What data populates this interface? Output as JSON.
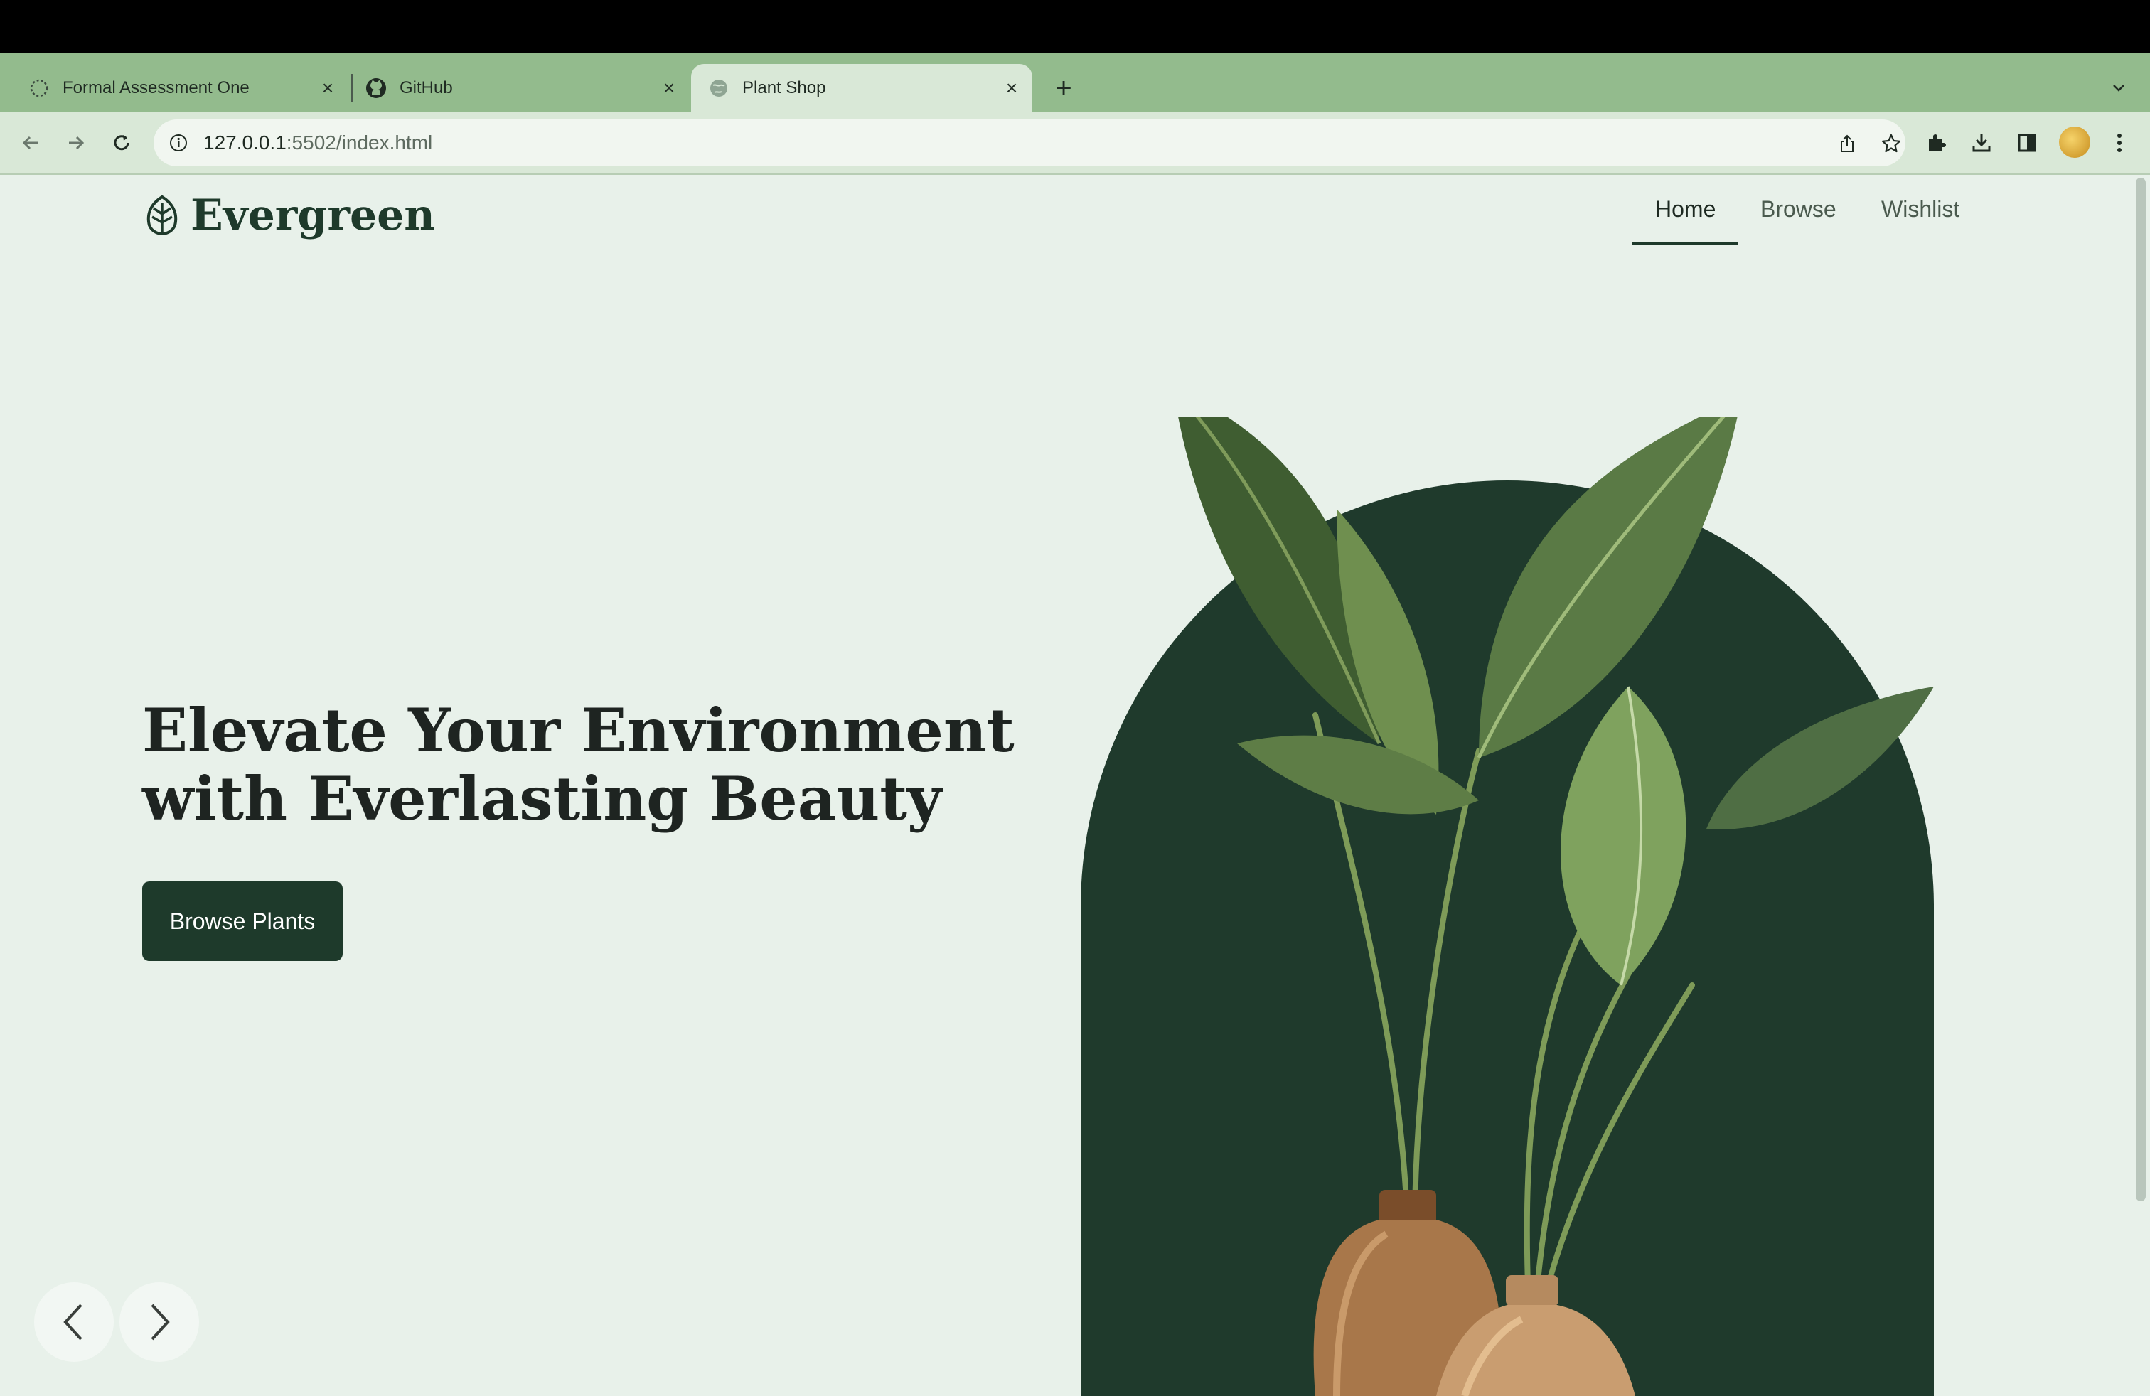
{
  "browser": {
    "tabs": [
      {
        "title": "Formal Assessment One",
        "icon": "loading-circle-icon",
        "active": false
      },
      {
        "title": "GitHub",
        "icon": "github-icon",
        "active": false
      },
      {
        "title": "Plant Shop",
        "icon": "globe-icon",
        "active": true
      }
    ],
    "url_host": "127.0.0.1",
    "url_rest": ":5502/index.html"
  },
  "site": {
    "brand": "Evergreen",
    "nav": [
      {
        "label": "Home",
        "active": true
      },
      {
        "label": "Browse",
        "active": false
      },
      {
        "label": "Wishlist",
        "active": false
      }
    ]
  },
  "hero": {
    "title_line1": "Elevate Your Environment",
    "title_line2": "with Everlasting Beauty",
    "cta_label": "Browse Plants"
  },
  "colors": {
    "tabstrip": "#93bb8d",
    "toolbar": "#d9e8d7",
    "page_bg": "#e8f1ea",
    "brand_dark": "#1e3a2b",
    "arch": "#1f3a2c"
  }
}
